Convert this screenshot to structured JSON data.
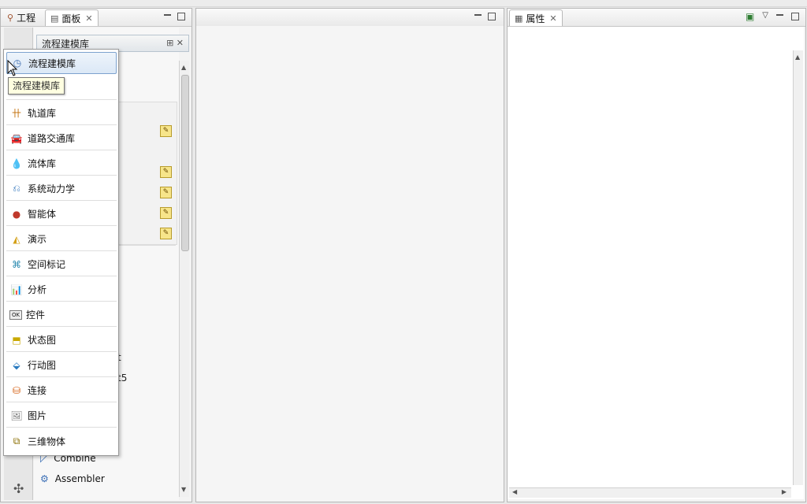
{
  "left_pane": {
    "tabs": [
      {
        "label": "工程",
        "icon": "project-tree-icon"
      },
      {
        "label": "面板",
        "icon": "palette-icon"
      }
    ],
    "section_header": "流程建模库",
    "visible_palette_items": [
      {
        "label": "t",
        "icon": ""
      },
      {
        "label": "t5",
        "icon": ""
      },
      {
        "label": "Combine",
        "icon": "combine-icon"
      },
      {
        "label": "Assembler",
        "icon": "assembler-icon"
      }
    ]
  },
  "library_menu": {
    "tooltip": "流程建模库",
    "items": [
      {
        "label": "流程建模库",
        "icon": "process-library-icon"
      },
      {
        "label": "",
        "icon": ""
      },
      {
        "label": "轨道库",
        "icon": "rail-library-icon"
      },
      {
        "label": "道路交通库",
        "icon": "road-traffic-icon"
      },
      {
        "label": "流体库",
        "icon": "fluid-drop-icon"
      },
      {
        "label": "系统动力学",
        "icon": "system-dynamics-icon"
      },
      {
        "label": "智能体",
        "icon": "agent-icon"
      },
      {
        "label": "演示",
        "icon": "presentation-shapes-icon"
      },
      {
        "label": "空间标记",
        "icon": "space-markup-icon"
      },
      {
        "label": "分析",
        "icon": "analysis-chart-icon"
      },
      {
        "label": "控件",
        "icon": "controls-ok-icon"
      },
      {
        "label": "状态图",
        "icon": "statechart-icon"
      },
      {
        "label": "行动图",
        "icon": "action-chart-icon"
      },
      {
        "label": "连接",
        "icon": "connectivity-icon"
      },
      {
        "label": "图片",
        "icon": "pictures-icon"
      },
      {
        "label": "三维物体",
        "icon": "3d-objects-icon"
      }
    ]
  },
  "props_pane": {
    "tab_label": "属性"
  },
  "colors": {
    "selection_border": "#7da2ce",
    "tooltip_bg": "#ffffe1",
    "pencil_bg": "#f7e58a"
  }
}
